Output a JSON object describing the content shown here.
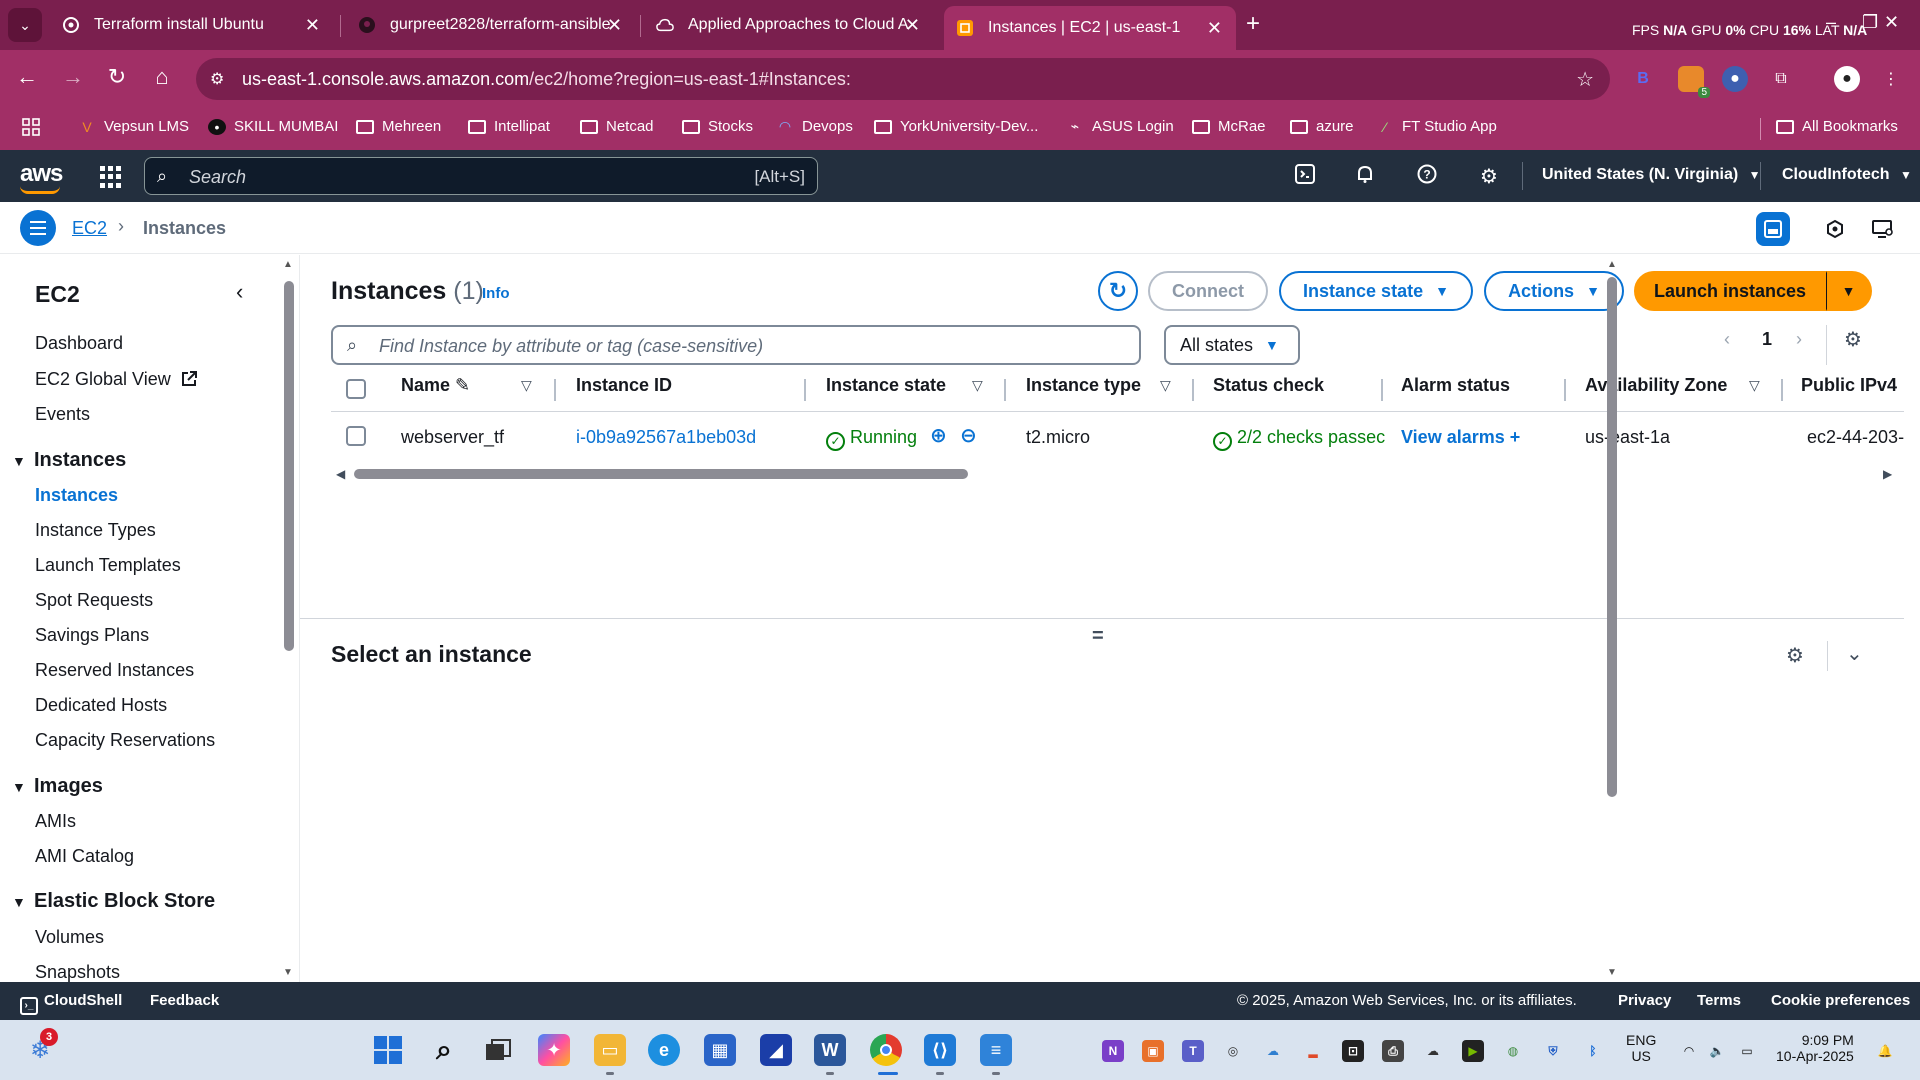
{
  "browser": {
    "tabs": [
      {
        "title": "Terraform install Ubuntu",
        "icon": "openai-icon"
      },
      {
        "title": "gurpreet2828/terraform-ansible",
        "icon": "github-icon"
      },
      {
        "title": "Applied Approaches to Cloud A",
        "icon": "cloud-icon"
      },
      {
        "title": "Instances | EC2 | us-east-1",
        "icon": "aws-icon"
      }
    ],
    "perf": {
      "fps_label": "FPS",
      "fps_value": "N/A",
      "gpu_label": "GPU",
      "gpu_value": "0%",
      "cpu_label": "CPU",
      "cpu_value": "16%",
      "lat_label": "LAT",
      "lat_value": "N/A"
    },
    "url_host": "us-east-1.console.aws.amazon.com",
    "url_path": "/ec2/home?region=us-east-1#Instances:",
    "extension_badge": "5",
    "bookmarks": [
      "Vepsun LMS",
      "SKILL MUMBAI",
      "Mehreen",
      "Intellipat",
      "Netcad",
      "Stocks",
      "Devops",
      "YorkUniversity-Dev...",
      "ASUS Login",
      "McRae",
      "azure",
      "FT Studio App"
    ],
    "all_bookmarks": "All Bookmarks"
  },
  "aws": {
    "logo": "aws",
    "search_placeholder": "Search",
    "search_shortcut": "[Alt+S]",
    "region": "United States (N. Virginia)",
    "account": "CloudInfotech"
  },
  "breadcrumb": {
    "root": "EC2",
    "current": "Instances"
  },
  "sidebar": {
    "title": "EC2",
    "top_items": [
      "Dashboard",
      "EC2 Global View",
      "Events"
    ],
    "sections": [
      {
        "title": "Instances",
        "items": [
          "Instances",
          "Instance Types",
          "Launch Templates",
          "Spot Requests",
          "Savings Plans",
          "Reserved Instances",
          "Dedicated Hosts",
          "Capacity Reservations"
        ]
      },
      {
        "title": "Images",
        "items": [
          "AMIs",
          "AMI Catalog"
        ]
      },
      {
        "title": "Elastic Block Store",
        "items": [
          "Volumes",
          "Snapshots"
        ]
      }
    ],
    "active_item": "Instances"
  },
  "main": {
    "title": "Instances",
    "count": "(1)",
    "info": "Info",
    "buttons": {
      "connect": "Connect",
      "instance_state": "Instance state",
      "actions": "Actions",
      "launch": "Launch instances"
    },
    "filter_placeholder": "Find Instance by attribute or tag (case-sensitive)",
    "states_filter": "All states",
    "page": "1",
    "columns": [
      "Name",
      "Instance ID",
      "Instance state",
      "Instance type",
      "Status check",
      "Alarm status",
      "Availability Zone",
      "Public IPv4"
    ],
    "rows": [
      {
        "name": "webserver_tf",
        "instance_id": "i-0b9a92567a1beb03d",
        "state": "Running",
        "type": "t2.micro",
        "status_check": "2/2 checks passec",
        "alarm": "View alarms",
        "az": "us-east-1a",
        "public_ipv4": "ec2-44-203-"
      }
    ],
    "details_title": "Select an instance"
  },
  "footer": {
    "cloudshell": "CloudShell",
    "feedback": "Feedback",
    "copyright": "© 2025, Amazon Web Services, Inc. or its affiliates.",
    "privacy": "Privacy",
    "terms": "Terms",
    "cookies": "Cookie preferences"
  },
  "taskbar": {
    "weather_badge": "3",
    "lang": "ENG",
    "locale": "US",
    "time": "9:09 PM",
    "date": "10-Apr-2025"
  },
  "colors": {
    "browser_frame": "#7a1f4e",
    "browser_toolbar": "#a12f66",
    "aws_header": "#232f3e",
    "link_blue": "#0972d3",
    "launch_orange": "#ff9900",
    "running_green": "#037f0c"
  }
}
